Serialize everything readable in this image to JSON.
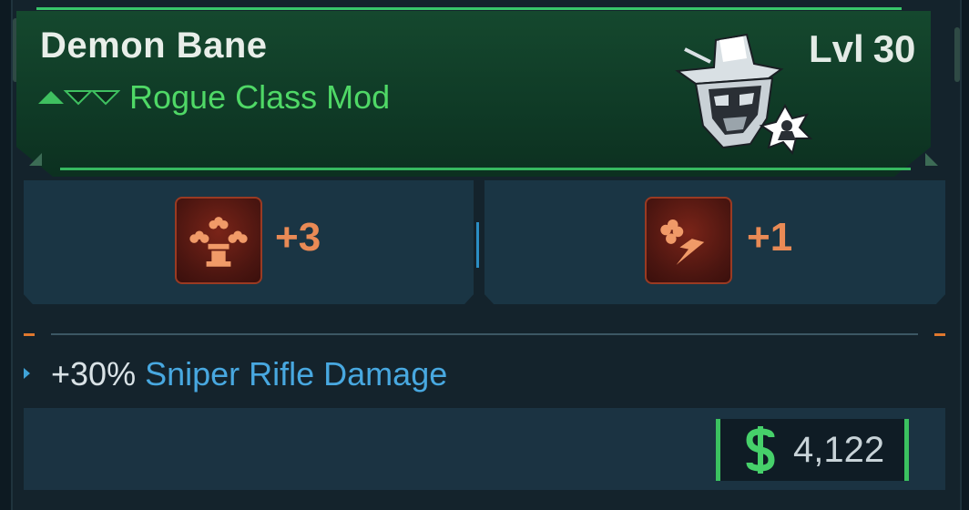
{
  "item": {
    "name": "Demon Bane",
    "type": "Rogue Class Mod",
    "level_label": "Lvl",
    "level_value": "30",
    "rarity_color": "#4fd866",
    "manufacturer_icon": "masked-skull-emblem-icon"
  },
  "skills": [
    {
      "icon": "clover-totem-skill-icon",
      "value": "+3"
    },
    {
      "icon": "clover-lightning-skill-icon",
      "value": "+1"
    }
  ],
  "stat": {
    "value": "+30%",
    "label": "Sniper Rifle Damage"
  },
  "price": {
    "icon": "dollar-icon",
    "value": "4,122"
  },
  "colors": {
    "header_bg": "#15482e",
    "accent_green": "#38c66a",
    "skill_value": "#e98a55",
    "stat_blue": "#48a8e0",
    "tick_orange": "#e0782e"
  }
}
